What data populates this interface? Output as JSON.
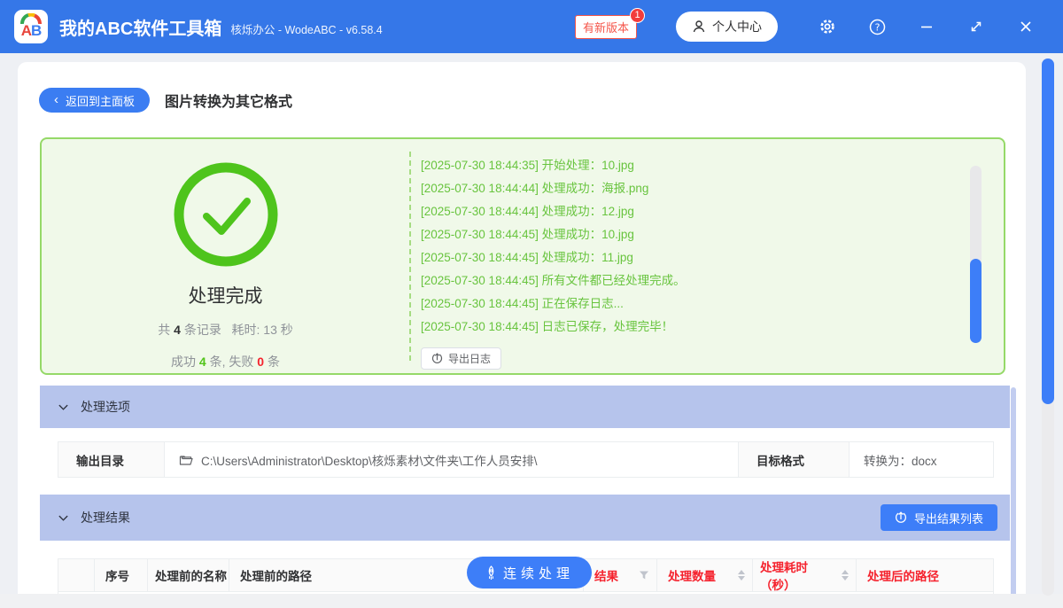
{
  "titlebar": {
    "logo_a": "A",
    "logo_b": "B",
    "title": "我的ABC软件工具箱",
    "subtitle": "核烁办公 - WodeABC - v6.58.4",
    "update_badge": "有新版本",
    "update_count": "1",
    "profile_label": "个人中心"
  },
  "toolbar": {
    "back_chevron": "‹",
    "back_label": "返回到主面板",
    "page_title": "图片转换为其它格式"
  },
  "result_panel": {
    "status": "处理完成",
    "total_prefix": "共",
    "total_count": "4",
    "total_suffix": "条记录",
    "time_text": "耗时: 13 秒",
    "success_label": "成功",
    "success_count": "4",
    "success_suffix": "条,",
    "fail_label": "失败",
    "fail_count": "0",
    "fail_suffix": "条",
    "export_log_label": "导出日志",
    "logs": [
      "[2025-07-30 18:44:35] 开始处理：10.jpg",
      "[2025-07-30 18:44:44] 处理成功：海报.png",
      "[2025-07-30 18:44:44] 处理成功：12.jpg",
      "[2025-07-30 18:44:45] 处理成功：10.jpg",
      "[2025-07-30 18:44:45] 处理成功：11.jpg",
      "[2025-07-30 18:44:45] 所有文件都已经处理完成。",
      "[2025-07-30 18:44:45] 正在保存日志...",
      "[2025-07-30 18:44:45] 日志已保存，处理完毕！"
    ]
  },
  "options_section": {
    "title": "处理选项",
    "output_dir_label": "输出目录",
    "output_dir_value": "C:\\Users\\Administrator\\Desktop\\核烁素材\\文件夹\\工作人员安排\\",
    "target_format_label": "目标格式",
    "target_format_value": "转换为：docx"
  },
  "results_section": {
    "title": "处理结果",
    "export_list_label": "导出结果列表",
    "continue_label": "连续处理",
    "columns": [
      {
        "label": ""
      },
      {
        "label": "序号"
      },
      {
        "label": "处理前的名称"
      },
      {
        "label": "处理前的路径"
      },
      {
        "label": "结果"
      },
      {
        "label": "处理数量"
      },
      {
        "label": "处理耗时（秒）"
      },
      {
        "label": "处理后的路径"
      }
    ]
  },
  "colors": {
    "titlebar": "#3577e8",
    "accent_button": "#3d7ef8",
    "success_green": "#52c41a",
    "success_panel_bg": "#f0f9e9",
    "success_panel_border": "#95d968",
    "section_header_bg": "#b6c4ec",
    "danger_red": "#f5222d"
  }
}
